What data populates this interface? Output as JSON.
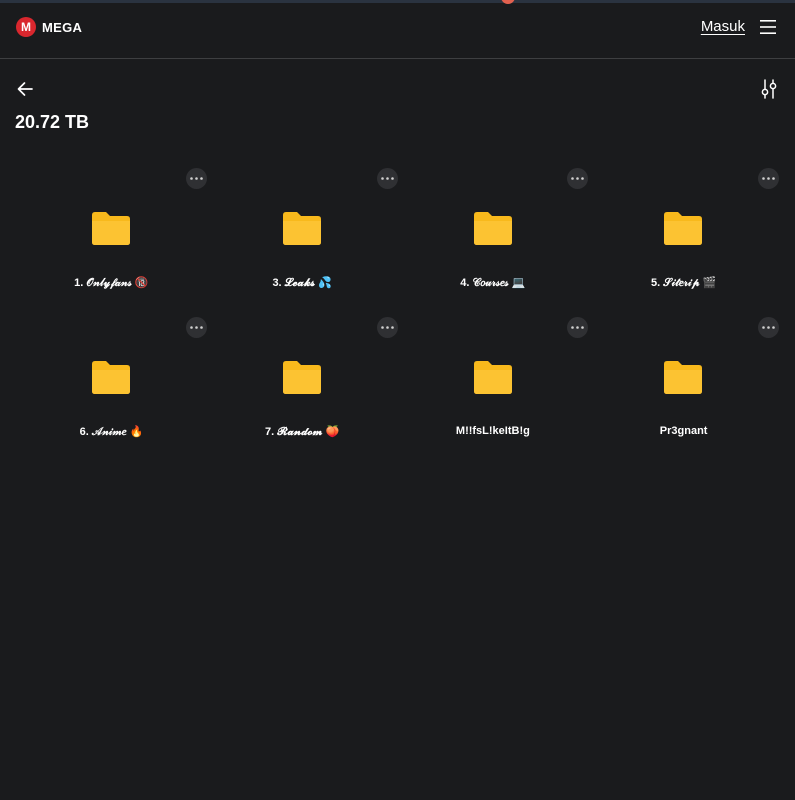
{
  "header": {
    "logo_text": "MEGA",
    "logo_letter": "M",
    "login_label": "Masuk",
    "menu_icon": "hamburger-menu-icon"
  },
  "toolbar": {
    "back_icon": "arrow-left-icon",
    "sort_icon": "sort-filter-icon"
  },
  "summary": {
    "total_size": "20.72 TB"
  },
  "colors": {
    "background": "#1a1b1d",
    "brand_red": "#d9272e",
    "folder_yellow": "#f8b91c"
  },
  "folders": [
    {
      "name": "1. 𝒪𝓃𝓁𝓎𝒻𝒶𝓃𝓈 🔞"
    },
    {
      "name": "3. 𝓛𝓮𝓪𝓴𝓼 💦"
    },
    {
      "name": "4. 𝒞𝑜𝓊𝓇𝓈𝑒𝓈 💻"
    },
    {
      "name": "5. 𝒮𝒾𝓉𝑒𝓇𝒾𝓅 🎬"
    },
    {
      "name": "6. 𝒜𝓃𝒾𝓂𝑒 🔥"
    },
    {
      "name": "7. 𝓡𝓪𝓷𝓭𝓸𝓶 🍑"
    },
    {
      "name": "M!!fsL!keItB!g"
    },
    {
      "name": "Pr3gnant"
    }
  ]
}
